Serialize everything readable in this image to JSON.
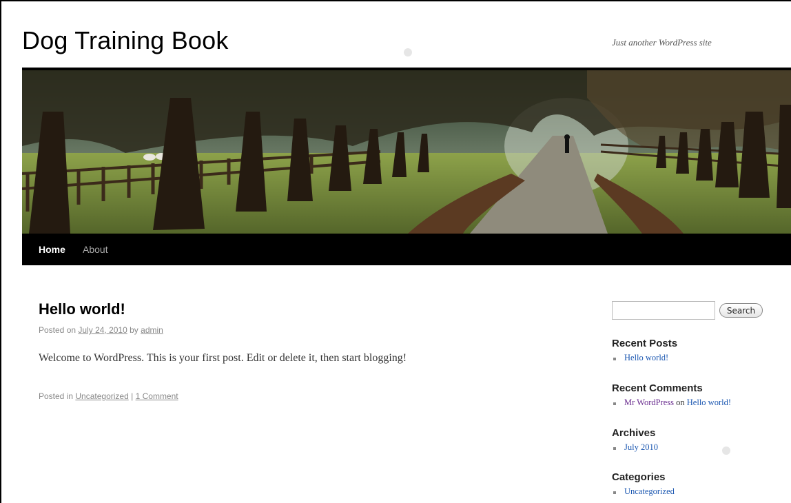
{
  "site": {
    "title": "Dog Training Book",
    "tagline": "Just another WordPress site"
  },
  "nav": {
    "items": [
      {
        "label": "Home",
        "current": true
      },
      {
        "label": "About",
        "current": false
      }
    ]
  },
  "post": {
    "title": "Hello world!",
    "meta": {
      "prefix": "Posted on",
      "date": "July 24, 2010",
      "by": "by",
      "author": "admin"
    },
    "content": "Welcome to WordPress. This is your first post. Edit or delete it, then start blogging!",
    "footer": {
      "prefix": "Posted in",
      "category": "Uncategorized",
      "separator": "|",
      "comments": "1 Comment"
    }
  },
  "sidebar": {
    "search": {
      "value": "",
      "button_label": "Search"
    },
    "recent_posts": {
      "title": "Recent Posts",
      "items": [
        "Hello world!"
      ]
    },
    "recent_comments": {
      "title": "Recent Comments",
      "items": [
        {
          "author": "Mr WordPress",
          "on": "on",
          "post": "Hello world!"
        }
      ]
    },
    "archives": {
      "title": "Archives",
      "items": [
        "July 2010"
      ]
    },
    "categories": {
      "title": "Categories",
      "items": [
        "Uncategorized"
      ]
    }
  },
  "colors": {
    "nav_background": "#000000",
    "link": "#1b57b1",
    "visited_link": "#6a2d8f"
  }
}
